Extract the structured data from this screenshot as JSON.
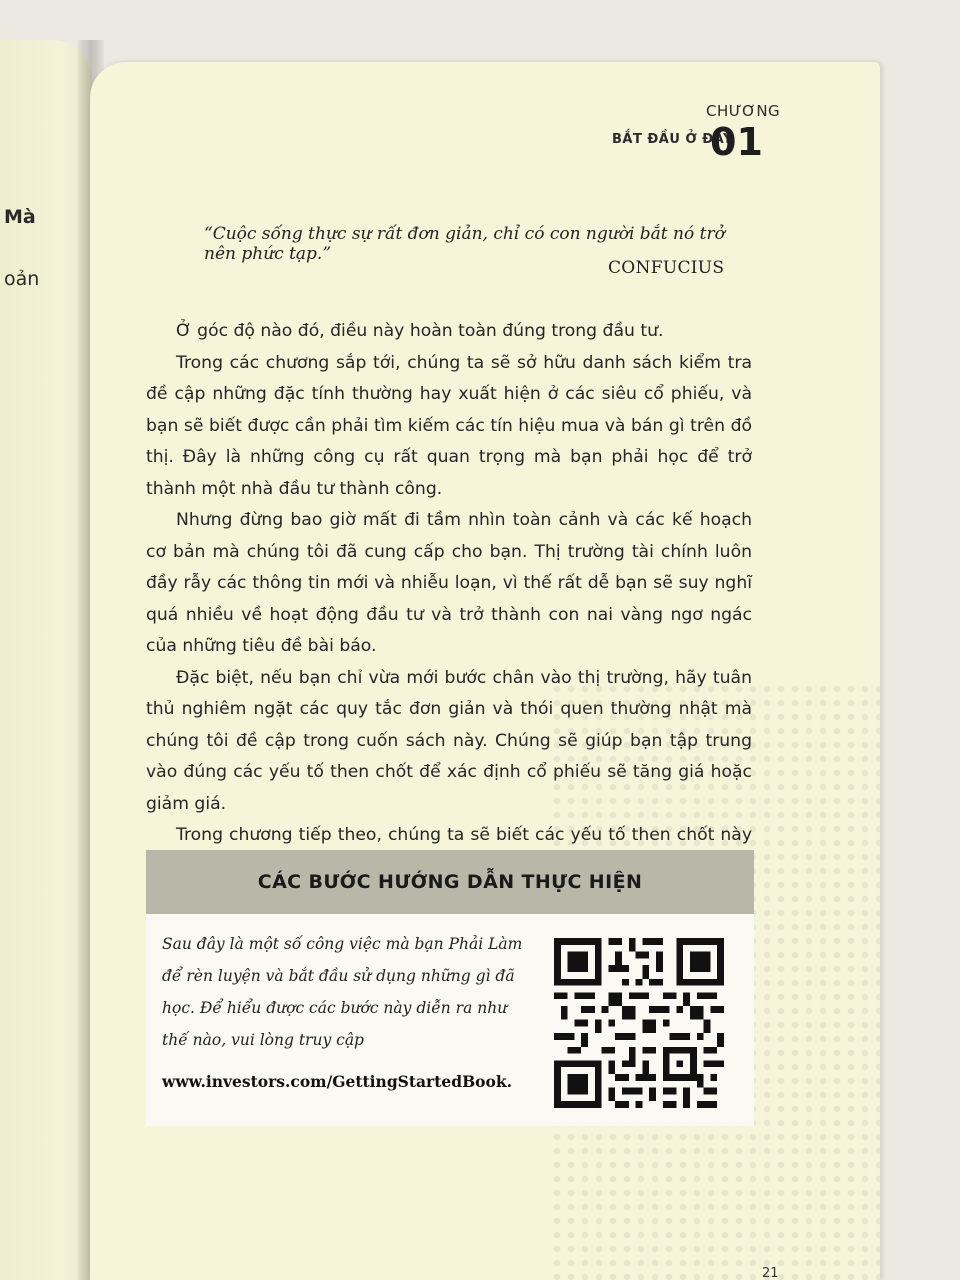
{
  "left_page": {
    "fragments": [
      "Mà",
      "oản"
    ]
  },
  "header": {
    "section_title": "BẮT ĐẦU Ở ĐÂY",
    "chapter_label": "CHƯƠNG",
    "chapter_number": "01"
  },
  "quote": {
    "text": "“Cuộc sống thực sự rất đơn giản, chỉ có con người bắt nó trở nên phức tạp.”",
    "author": "CONFUCIUS"
  },
  "paragraphs": [
    "Ở góc độ nào đó, điều này hoàn toàn đúng trong đầu tư.",
    "Trong các chương sắp tới, chúng ta sẽ sở hữu danh sách kiểm tra đề cập những đặc tính thường hay xuất hiện ở các siêu cổ phiếu, và bạn sẽ biết được cần phải tìm kiếm các tín hiệu mua và bán gì trên đồ thị. Đây là những công cụ rất quan trọng mà bạn phải học để trở thành một nhà đầu tư thành công.",
    "Nhưng đừng bao giờ mất đi tầm nhìn toàn cảnh và các kế hoạch cơ bản mà chúng tôi đã cung cấp cho bạn. Thị trường tài chính luôn đầy rẫy các thông tin mới và nhiễu loạn, vì thế rất dễ bạn sẽ suy nghĩ quá nhiều về hoạt động đầu tư và trở thành con nai vàng ngơ ngác của những tiêu đề bài báo.",
    "Đặc biệt, nếu bạn chỉ vừa mới bước chân vào thị trường, hãy tuân thủ nghiêm ngặt các quy tắc đơn giản và thói quen thường nhật mà chúng tôi đề cập trong cuốn sách này. Chúng sẽ giúp bạn tập trung vào đúng các yếu tố then chốt để xác định cổ phiếu sẽ tăng giá hoặc giảm giá.",
    "Trong chương tiếp theo, chúng ta sẽ biết các yếu tố then chốt này là gì."
  ],
  "steps_box": {
    "title": "CÁC BƯỚC HƯỚNG DẪN THỰC HIỆN",
    "text": "Sau đây là một số công việc mà bạn Phải Làm để rèn luyện và bắt đầu sử dụng những gì đã học. Để hiểu được các bước này diễn ra như thế nào, vui lòng truy cập",
    "url": "www.investors.com/GettingStartedBook.",
    "qr_icon": "qr-code-icon"
  },
  "page_number": "21"
}
